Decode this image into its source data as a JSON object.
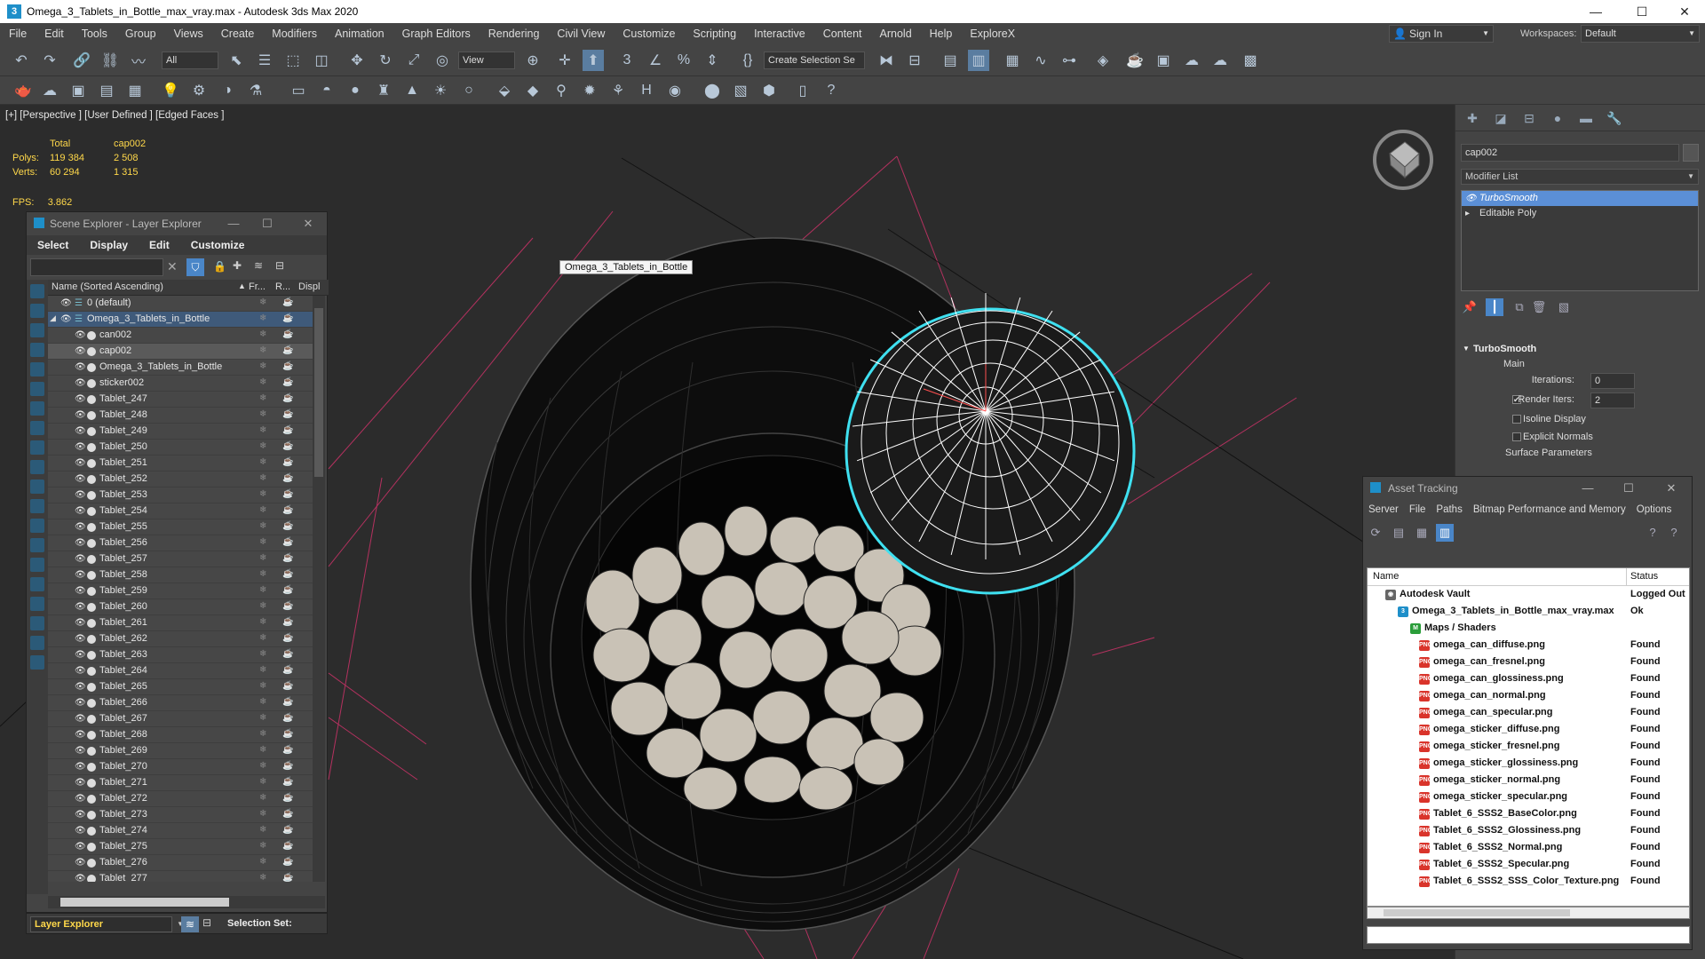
{
  "window": {
    "title": "Omega_3_Tablets_in_Bottle_max_vray.max - Autodesk 3ds Max 2020",
    "minimize": "—",
    "maximize": "☐",
    "close": "✕"
  },
  "menu": [
    "File",
    "Edit",
    "Tools",
    "Group",
    "Views",
    "Create",
    "Modifiers",
    "Animation",
    "Graph Editors",
    "Rendering",
    "Civil View",
    "Customize",
    "Scripting",
    "Interactive",
    "Content",
    "Arnold",
    "Help",
    "ExploreX"
  ],
  "account": {
    "sign_in": "Sign In",
    "workspaces_label": "Workspaces:",
    "workspace": "Default"
  },
  "toolbar": {
    "filter": "All",
    "ref_coord": "View",
    "selection_set": "Create Selection Se"
  },
  "viewport": {
    "label": "[+] [Perspective ] [User Defined ] [Edged Faces ]",
    "stats": {
      "total_label": "Total",
      "object_label": "cap002",
      "polys_label": "Polys:",
      "polys_total": "119 384",
      "polys_obj": "2 508",
      "verts_label": "Verts:",
      "verts_total": "60 294",
      "verts_obj": "1 315"
    },
    "fps_label": "FPS:",
    "fps": "3.862",
    "tooltip": "Omega_3_Tablets_in_Bottle"
  },
  "scene_explorer": {
    "title": "Scene Explorer - Layer Explorer",
    "menu": [
      "Select",
      "Display",
      "Edit",
      "Customize"
    ],
    "columns": {
      "name": "Name (Sorted Ascending)",
      "frozen": "Fr...",
      "render": "R...",
      "display": "Displ"
    },
    "rows": [
      {
        "name": "0 (default)",
        "indent": 0,
        "type": "layer"
      },
      {
        "name": "Omega_3_Tablets_in_Bottle",
        "indent": 0,
        "type": "layer-active"
      },
      {
        "name": "can002",
        "indent": 1,
        "type": "object"
      },
      {
        "name": "cap002",
        "indent": 1,
        "type": "object",
        "selected": true
      },
      {
        "name": "Omega_3_Tablets_in_Bottle",
        "indent": 1,
        "type": "group"
      },
      {
        "name": "sticker002",
        "indent": 1,
        "type": "object"
      },
      {
        "name": "Tablet_247",
        "indent": 1,
        "type": "object"
      },
      {
        "name": "Tablet_248",
        "indent": 1,
        "type": "object"
      },
      {
        "name": "Tablet_249",
        "indent": 1,
        "type": "object"
      },
      {
        "name": "Tablet_250",
        "indent": 1,
        "type": "object"
      },
      {
        "name": "Tablet_251",
        "indent": 1,
        "type": "object"
      },
      {
        "name": "Tablet_252",
        "indent": 1,
        "type": "object"
      },
      {
        "name": "Tablet_253",
        "indent": 1,
        "type": "object"
      },
      {
        "name": "Tablet_254",
        "indent": 1,
        "type": "object"
      },
      {
        "name": "Tablet_255",
        "indent": 1,
        "type": "object"
      },
      {
        "name": "Tablet_256",
        "indent": 1,
        "type": "object"
      },
      {
        "name": "Tablet_257",
        "indent": 1,
        "type": "object"
      },
      {
        "name": "Tablet_258",
        "indent": 1,
        "type": "object"
      },
      {
        "name": "Tablet_259",
        "indent": 1,
        "type": "object"
      },
      {
        "name": "Tablet_260",
        "indent": 1,
        "type": "object"
      },
      {
        "name": "Tablet_261",
        "indent": 1,
        "type": "object"
      },
      {
        "name": "Tablet_262",
        "indent": 1,
        "type": "object"
      },
      {
        "name": "Tablet_263",
        "indent": 1,
        "type": "object"
      },
      {
        "name": "Tablet_264",
        "indent": 1,
        "type": "object"
      },
      {
        "name": "Tablet_265",
        "indent": 1,
        "type": "object"
      },
      {
        "name": "Tablet_266",
        "indent": 1,
        "type": "object"
      },
      {
        "name": "Tablet_267",
        "indent": 1,
        "type": "object"
      },
      {
        "name": "Tablet_268",
        "indent": 1,
        "type": "object"
      },
      {
        "name": "Tablet_269",
        "indent": 1,
        "type": "object"
      },
      {
        "name": "Tablet_270",
        "indent": 1,
        "type": "object"
      },
      {
        "name": "Tablet_271",
        "indent": 1,
        "type": "object"
      },
      {
        "name": "Tablet_272",
        "indent": 1,
        "type": "object"
      },
      {
        "name": "Tablet_273",
        "indent": 1,
        "type": "object"
      },
      {
        "name": "Tablet_274",
        "indent": 1,
        "type": "object"
      },
      {
        "name": "Tablet_275",
        "indent": 1,
        "type": "object"
      },
      {
        "name": "Tablet_276",
        "indent": 1,
        "type": "object"
      },
      {
        "name": "Tablet_277",
        "indent": 1,
        "type": "object"
      }
    ],
    "layer_dropdown": "Layer Explorer",
    "selection_set_label": "Selection Set:"
  },
  "command_panel": {
    "object_name": "cap002",
    "modifier_list": "Modifier List",
    "stack": [
      {
        "name": "TurboSmooth",
        "selected": true
      },
      {
        "name": "Editable Poly",
        "selected": false
      }
    ],
    "rollout": {
      "title": "TurboSmooth",
      "main_label": "Main",
      "iterations_label": "Iterations:",
      "iterations": "0",
      "render_iters_label": "Render Iters:",
      "render_iters": "2",
      "render_iters_checked": true,
      "isoline_label": "Isoline Display",
      "explicit_normals_label": "Explicit Normals",
      "surface_params_label": "Surface Parameters"
    }
  },
  "asset_tracking": {
    "title": "Asset Tracking",
    "menu": [
      "Server",
      "File",
      "Paths",
      "Bitmap Performance and Memory",
      "Options"
    ],
    "columns": {
      "name": "Name",
      "status": "Status"
    },
    "rows": [
      {
        "name": "Autodesk Vault",
        "status": "Logged Out",
        "level": 0,
        "icon": "vault"
      },
      {
        "name": "Omega_3_Tablets_in_Bottle_max_vray.max",
        "status": "Ok",
        "level": 1,
        "icon": "max"
      },
      {
        "name": "Maps / Shaders",
        "status": "",
        "level": 2,
        "icon": "maps"
      },
      {
        "name": "omega_can_diffuse.png",
        "status": "Found",
        "level": 3,
        "icon": "png"
      },
      {
        "name": "omega_can_fresnel.png",
        "status": "Found",
        "level": 3,
        "icon": "png"
      },
      {
        "name": "omega_can_glossiness.png",
        "status": "Found",
        "level": 3,
        "icon": "png"
      },
      {
        "name": "omega_can_normal.png",
        "status": "Found",
        "level": 3,
        "icon": "png"
      },
      {
        "name": "omega_can_specular.png",
        "status": "Found",
        "level": 3,
        "icon": "png"
      },
      {
        "name": "omega_sticker_diffuse.png",
        "status": "Found",
        "level": 3,
        "icon": "png"
      },
      {
        "name": "omega_sticker_fresnel.png",
        "status": "Found",
        "level": 3,
        "icon": "png"
      },
      {
        "name": "omega_sticker_glossiness.png",
        "status": "Found",
        "level": 3,
        "icon": "png"
      },
      {
        "name": "omega_sticker_normal.png",
        "status": "Found",
        "level": 3,
        "icon": "png"
      },
      {
        "name": "omega_sticker_specular.png",
        "status": "Found",
        "level": 3,
        "icon": "png"
      },
      {
        "name": "Tablet_6_SSS2_BaseColor.png",
        "status": "Found",
        "level": 3,
        "icon": "png"
      },
      {
        "name": "Tablet_6_SSS2_Glossiness.png",
        "status": "Found",
        "level": 3,
        "icon": "png"
      },
      {
        "name": "Tablet_6_SSS2_Normal.png",
        "status": "Found",
        "level": 3,
        "icon": "png"
      },
      {
        "name": "Tablet_6_SSS2_Specular.png",
        "status": "Found",
        "level": 3,
        "icon": "png"
      },
      {
        "name": "Tablet_6_SSS2_SSS_Color_Texture.png",
        "status": "Found",
        "level": 3,
        "icon": "png"
      }
    ]
  },
  "colors": {
    "selection_wire": "#3fe0f0",
    "stats_text": "#ffd84a",
    "highlight": "#5b8fd6",
    "png_icon": "#d9342b"
  }
}
